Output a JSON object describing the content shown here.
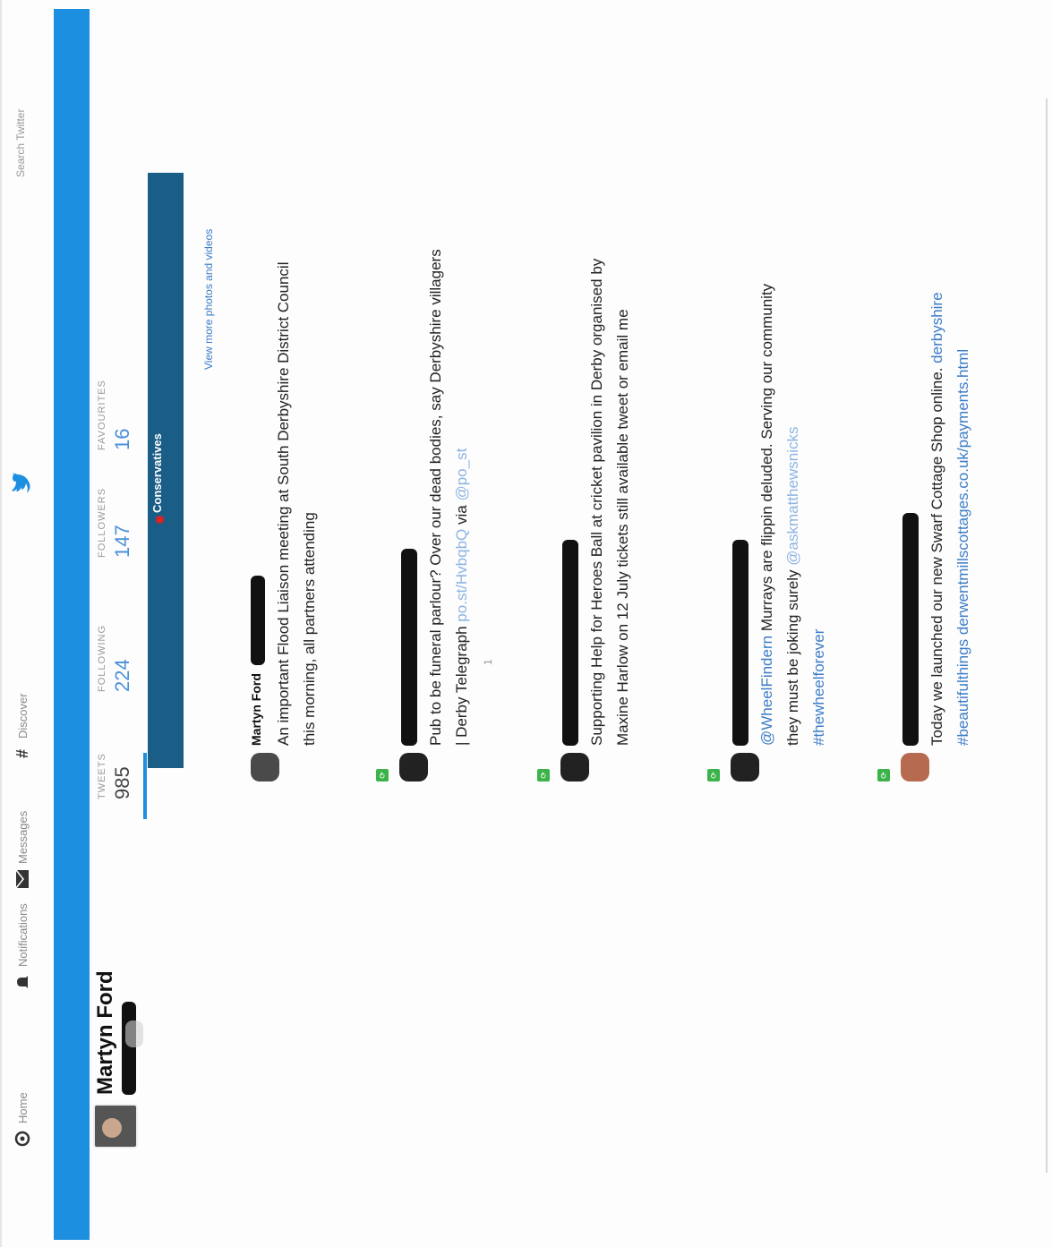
{
  "nav": {
    "home_label": "Home",
    "notifications_label": "Notifications",
    "messages_label": "Messages",
    "discover_label": "Discover",
    "search_placeholder": "Search Twitter"
  },
  "profile": {
    "name": "Martyn Ford",
    "stats": [
      {
        "label": "TWEETS",
        "value": "985"
      },
      {
        "label": "FOLLOWING",
        "value": "224"
      },
      {
        "label": "FOLLOWERS",
        "value": "147"
      },
      {
        "label": "FAVOURITES",
        "value": "16"
      }
    ],
    "cover_label": "Conservatives",
    "more_media": "View more photos and videos"
  },
  "tweets": [
    {
      "author": "Martyn Ford",
      "body_lines": [
        "An important Flood Liaison meeting at South Derbyshire District Council",
        "this morning, all partners attending"
      ]
    },
    {
      "body_lines": [
        "Pub to be funeral parlour? Over our dead bodies, say Derbyshire villagers",
        "| Derby Telegraph"
      ],
      "link_text": "po.st/HvbqbQ",
      "via_text": "via",
      "via_handle": "@po_st",
      "meta": "1"
    },
    {
      "body_lines": [
        "Supporting Help for Heroes Ball at cricket pavilion in Derby organised by",
        "Maxine Harlow on 12 July tickets still available tweet or email me"
      ]
    },
    {
      "mention": "@WheelFindern",
      "body_lines": [
        "Murrays are flippin deluded. Serving our community",
        "they must be joking surely"
      ],
      "mention_2": "@askmatthewsnicks",
      "hashtag": "#thewheelforever"
    },
    {
      "body_lines": [
        "Today we launched our new Swarf Cottage Shop online."
      ],
      "link_1": "derbyshire",
      "link_2": "#beautifulthings derwentmillscottages.co.uk/payments.html"
    }
  ]
}
